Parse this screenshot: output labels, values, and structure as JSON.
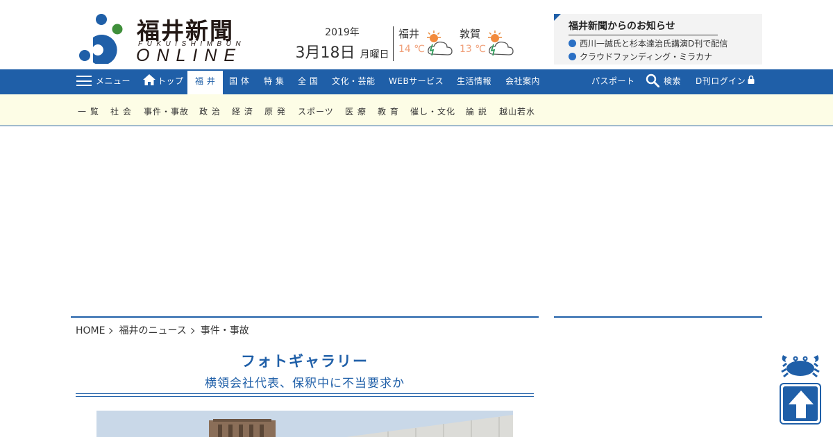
{
  "logo": {
    "jp": "福井新聞",
    "roman": "FUKUISHIMBUN",
    "online": "ONLINE"
  },
  "date": {
    "year": "2019年",
    "day": "3月18日",
    "dow": "月曜日"
  },
  "weather": [
    {
      "city": "福井",
      "temp": "14 ℃",
      "icon": "sun-cloud-icon"
    },
    {
      "city": "敦賀",
      "temp": "13 ℃",
      "icon": "sun-cloud-icon"
    }
  ],
  "notice": {
    "title": "福井新聞からのお知らせ",
    "items": [
      "西川一誠氏と杉本達治氏講演D刊で配信",
      "クラウドファンディング・ミラカナ"
    ]
  },
  "mainnav": {
    "menu": "メニュー",
    "top": "トップ",
    "items": [
      "福 井",
      "国 体",
      "特 集",
      "全 国",
      "文化・芸能",
      "WEBサービス",
      "生活情報",
      "会社案内"
    ],
    "passport": "パスポート",
    "search": "検索",
    "login": "D刊ログイン"
  },
  "subnav": {
    "items": [
      "一 覧",
      "社 会",
      "事件・事故",
      "政 治",
      "経 済",
      "原 発",
      "スポーツ",
      "医 療",
      "教 育",
      "催し・文化",
      "論 説",
      "越山若水"
    ]
  },
  "breadcrumb": [
    "HOME",
    "福井のニュース",
    "事件・事故"
  ],
  "gallery": {
    "title": "フォトギャラリー",
    "subtitle": "横領会社代表、保釈中に不当要求か"
  },
  "colors": {
    "brand_blue": "#1f5fa8",
    "subnav_bg": "#fdfde6",
    "temp_orange": "#f0a07a"
  }
}
